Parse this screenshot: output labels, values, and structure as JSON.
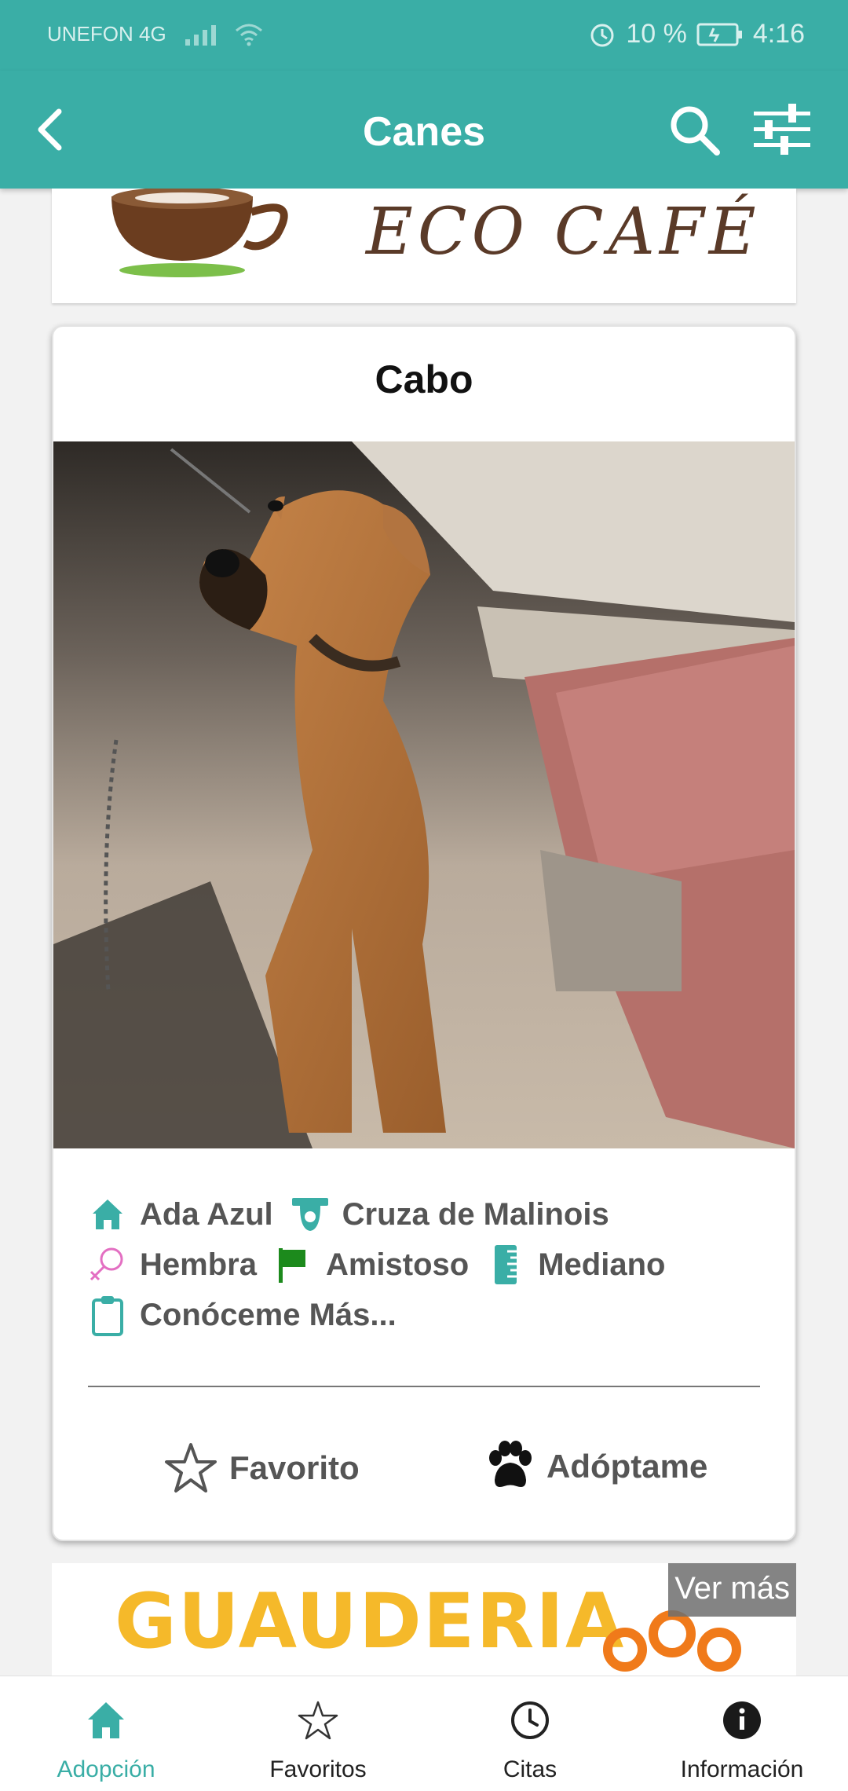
{
  "status_bar": {
    "carrier": "UNEFON 4G",
    "battery": "10 %",
    "time": "4:16"
  },
  "app_bar": {
    "title": "Canes"
  },
  "top_banner": {
    "text": "ECO CAFÉ"
  },
  "card": {
    "name": "Cabo",
    "attributes": {
      "shelter": "Ada Azul",
      "breed": "Cruza de Malinois",
      "sex": "Hembra",
      "temperament": "Amistoso",
      "size": "Mediano",
      "more": "Conóceme Más..."
    },
    "actions": {
      "favorite": "Favorito",
      "adopt": "Adóptame"
    }
  },
  "bottom_banner": {
    "text": "GUAUDERIA",
    "see_more": "Ver más"
  },
  "bottom_nav": {
    "items": [
      {
        "label": "Adopción",
        "icon": "home-icon",
        "active": true
      },
      {
        "label": "Favoritos",
        "icon": "star-icon",
        "active": false
      },
      {
        "label": "Citas",
        "icon": "clock-icon",
        "active": false
      },
      {
        "label": "Información",
        "icon": "info-icon",
        "active": false
      }
    ]
  },
  "colors": {
    "primary": "#3aaea6",
    "female": "#e36fc2",
    "flag": "#1c8a1c",
    "text_gray": "#555555"
  }
}
